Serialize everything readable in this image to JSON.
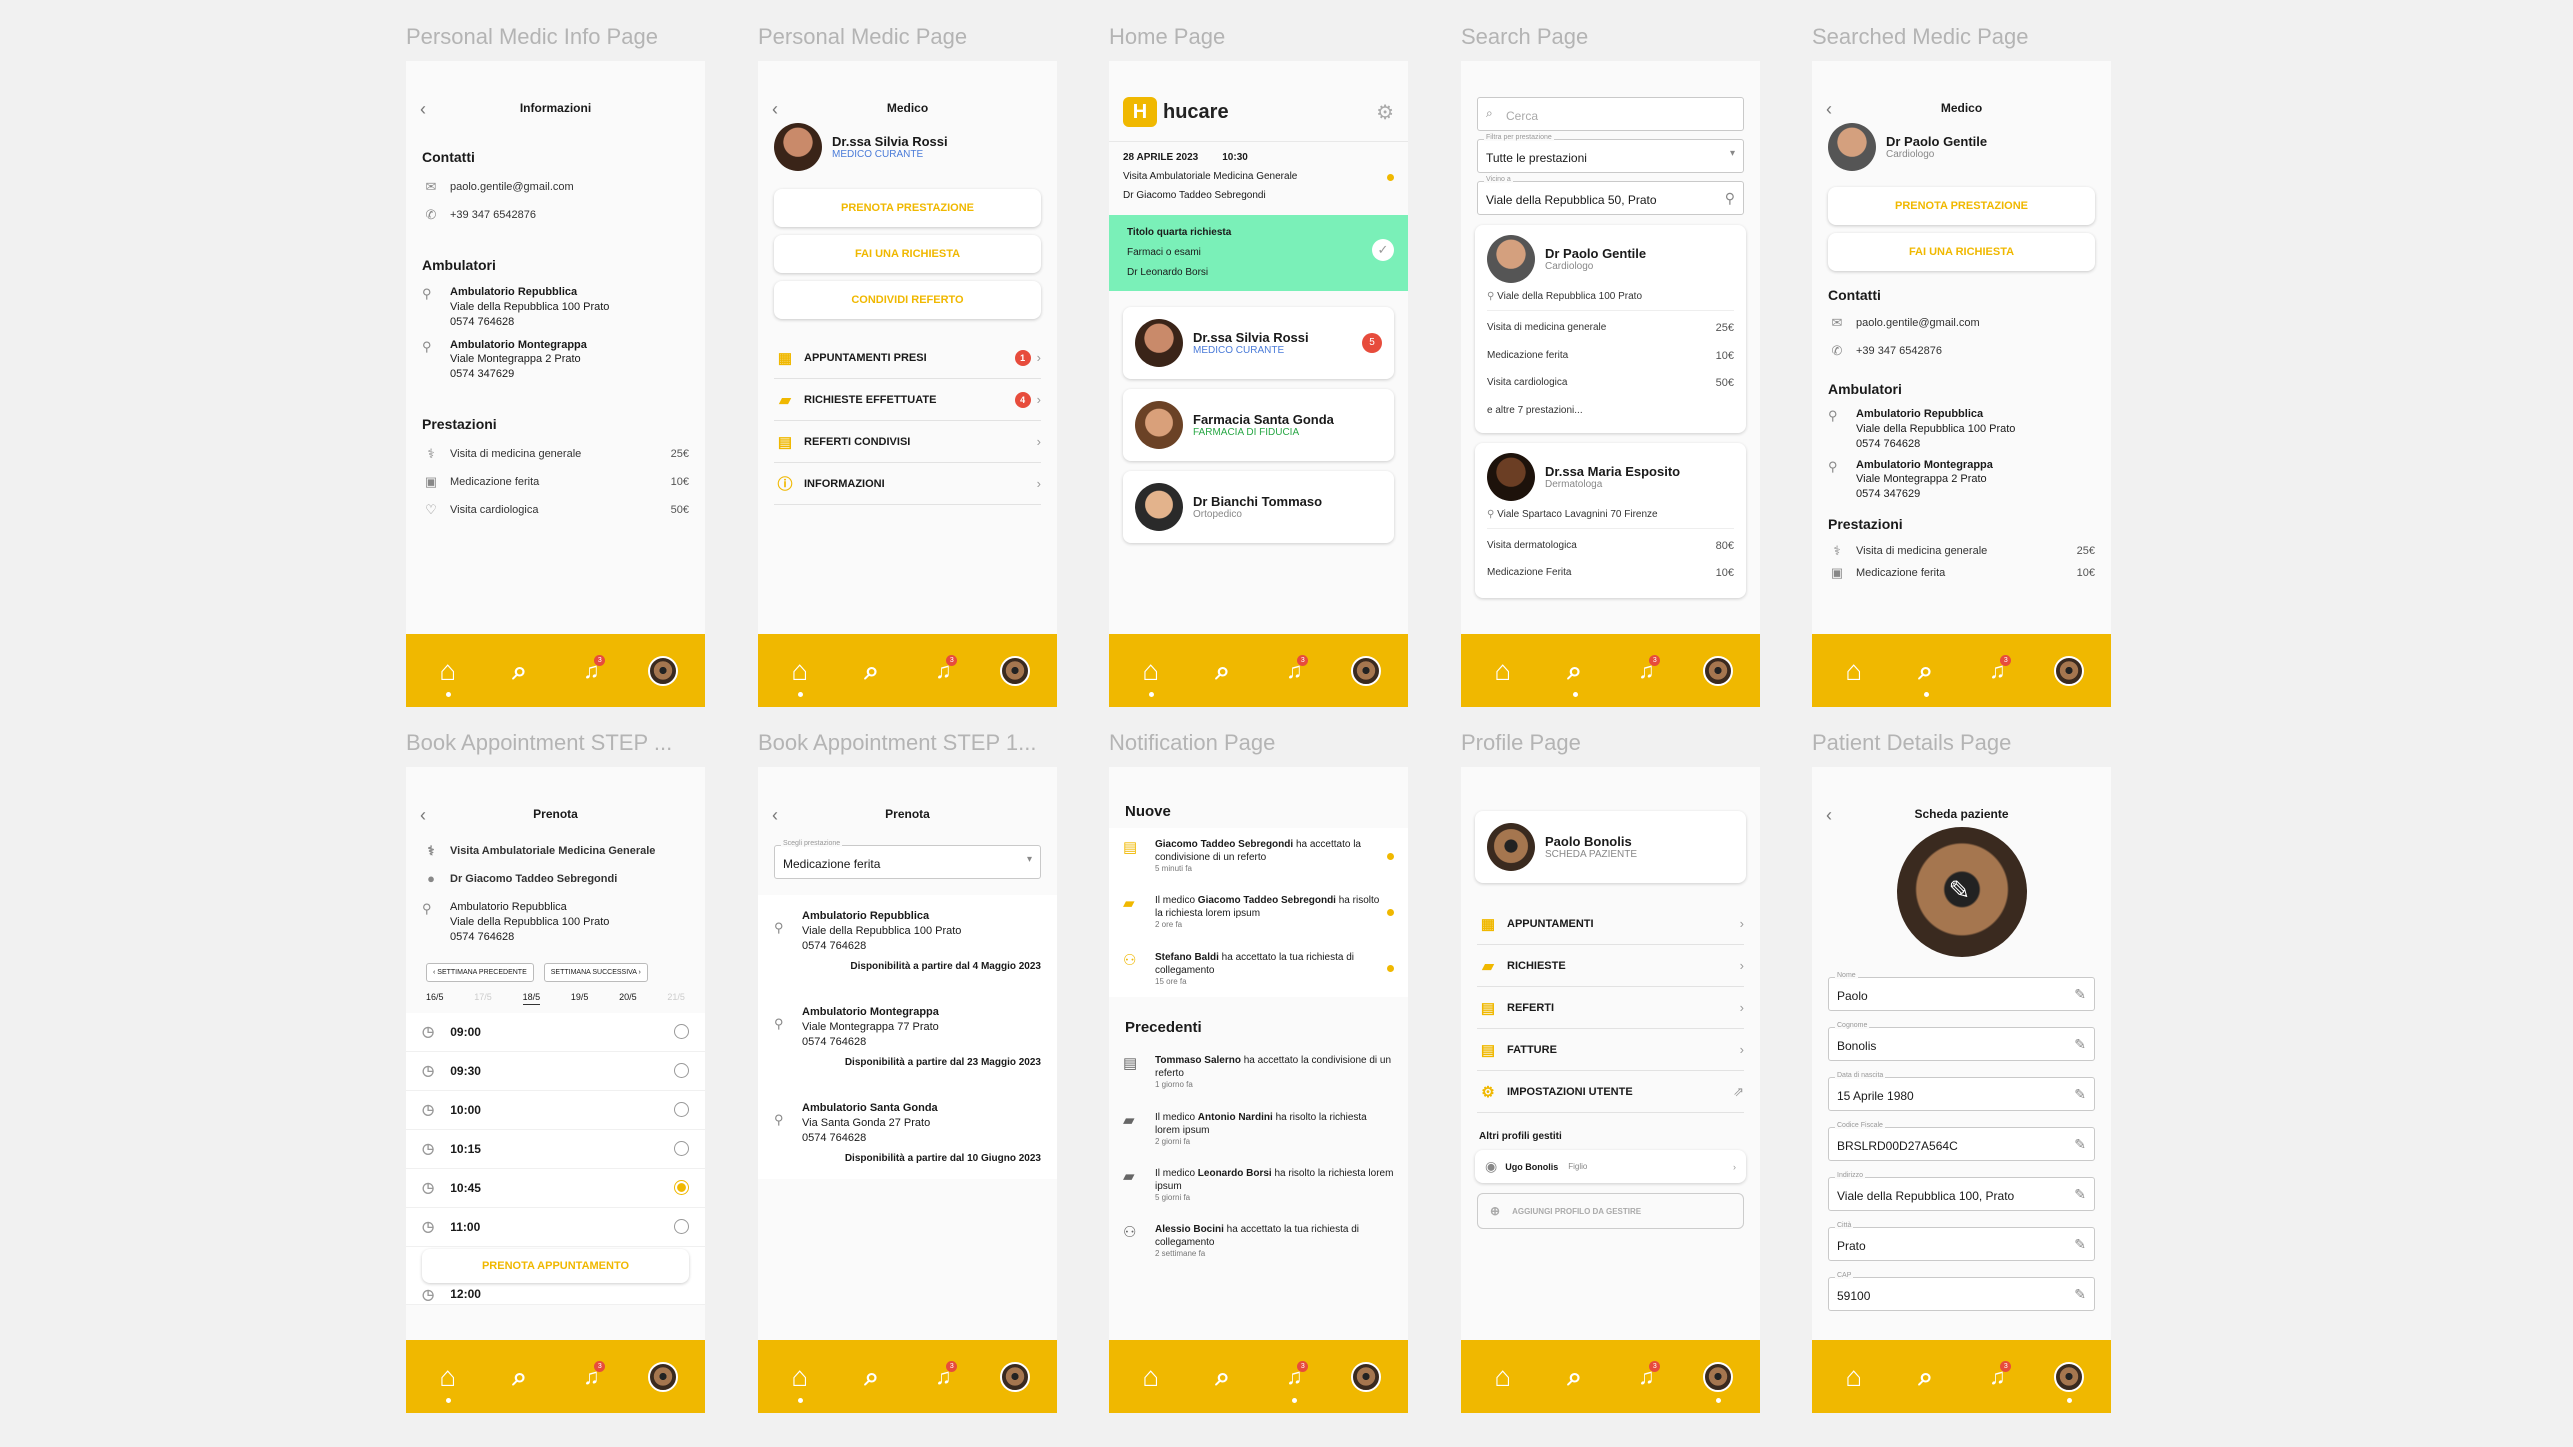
{
  "titles": [
    "Personal Medic Info Page",
    "Personal Medic Page",
    "Home Page",
    "Search Page",
    "Searched Medic Page",
    "Book Appointment STEP ...",
    "Book Appointment STEP 1...",
    "Notification Page",
    "Profile Page",
    "Patient Details Page"
  ],
  "nav": {
    "badge": "3"
  },
  "info": {
    "header": "Informazioni",
    "contacts_title": "Contatti",
    "email": "paolo.gentile@gmail.com",
    "phone": "+39 347 6542876",
    "ambulatori_title": "Ambulatori",
    "ambulatori": [
      {
        "name": "Ambulatorio Repubblica",
        "addr": "Viale della Repubblica 100 Prato",
        "tel": "0574 764628"
      },
      {
        "name": "Ambulatorio Montegrappa",
        "addr": "Viale Montegrappa 2 Prato",
        "tel": "0574 347629"
      }
    ],
    "prestazioni_title": "Prestazioni",
    "prestazioni": [
      {
        "name": "Visita di medicina generale",
        "price": "25€"
      },
      {
        "name": "Medicazione ferita",
        "price": "10€"
      },
      {
        "name": "Visita cardiologica",
        "price": "50€"
      }
    ]
  },
  "medic": {
    "header": "Medico",
    "name": "Dr.ssa Silvia Rossi",
    "role": "MEDICO CURANTE",
    "btn1": "PRENOTA PRESTAZIONE",
    "btn2": "FAI UNA RICHIESTA",
    "btn3": "CONDIVIDI REFERTO",
    "menu": [
      {
        "label": "APPUNTAMENTI PRESI",
        "badge": "1"
      },
      {
        "label": "RICHIESTE EFFETTUATE",
        "badge": "4"
      },
      {
        "label": "REFERTI CONDIVISI",
        "badge": ""
      },
      {
        "label": "INFORMAZIONI",
        "badge": ""
      }
    ]
  },
  "home": {
    "logo": "hucare",
    "appt": {
      "date": "28 APRILE 2023",
      "time": "10:30",
      "title": "Visita Ambulatoriale Medicina Generale",
      "doctor": "Dr Giacomo Taddeo Sebregondi"
    },
    "request": {
      "title": "Titolo quarta richiesta",
      "sub": "Farmaci o esami",
      "doctor": "Dr Leonardo Borsi"
    },
    "cards": [
      {
        "name": "Dr.ssa Silvia Rossi",
        "role": "MEDICO CURANTE",
        "badge": "5"
      },
      {
        "name": "Farmacia Santa Gonda",
        "role": "FARMACIA DI FIDUCIA",
        "badge": ""
      },
      {
        "name": "Dr Bianchi Tommaso",
        "role": "Ortopedico",
        "badge": ""
      }
    ]
  },
  "search": {
    "placeholder": "Cerca",
    "filter_label": "Filtra per prestazione",
    "filter_value": "Tutte le prestazioni",
    "near_label": "Vicino a",
    "near_value": "Viale della Repubblica 50, Prato",
    "r1": {
      "name": "Dr  Paolo Gentile",
      "role": "Cardiologo",
      "addr": "Viale della Repubblica 100 Prato",
      "services": [
        {
          "name": "Visita di medicina generale",
          "price": "25€"
        },
        {
          "name": "Medicazione ferita",
          "price": "10€"
        },
        {
          "name": "Visita cardiologica",
          "price": "50€"
        }
      ],
      "more": "e altre 7 prestazioni..."
    },
    "r2": {
      "name": "Dr.ssa  Maria Esposito",
      "role": "Dermatologa",
      "addr": "Viale Spartaco Lavagnini 70 Firenze",
      "services": [
        {
          "name": "Visita dermatologica",
          "price": "80€"
        },
        {
          "name": "Medicazione Ferita",
          "price": "10€"
        }
      ]
    }
  },
  "searched": {
    "header": "Medico",
    "name": "Dr  Paolo Gentile",
    "role": "Cardiologo",
    "btn1": "PRENOTA PRESTAZIONE",
    "btn2": "FAI UNA RICHIESTA",
    "contacts_title": "Contatti",
    "email": "paolo.gentile@gmail.com",
    "phone": "+39 347 6542876",
    "ambulatori_title": "Ambulatori",
    "ambulatori": [
      {
        "name": "Ambulatorio Repubblica",
        "addr": "Viale della Repubblica 100 Prato",
        "tel": "0574 764628"
      },
      {
        "name": "Ambulatorio Montegrappa",
        "addr": "Viale Montegrappa 2 Prato",
        "tel": "0574 347629"
      }
    ],
    "prestazioni_title": "Prestazioni",
    "prestazioni": [
      {
        "name": "Visita di medicina generale",
        "price": "25€"
      },
      {
        "name": "Medicazione ferita",
        "price": "10€"
      }
    ]
  },
  "book2": {
    "header": "Prenota",
    "service": "Visita Ambulatoriale Medicina Generale",
    "doctor": "Dr Giacomo Taddeo Sebregondi",
    "amb_name": "Ambulatorio Repubblica",
    "amb_addr": "Viale della Repubblica 100 Prato",
    "amb_tel": "0574 764628",
    "prev": "SETTIMANA PRECEDENTE",
    "next": "SETTIMANA SUCCESSIVA",
    "days": [
      "16/5",
      "17/5",
      "18/5",
      "19/5",
      "20/5",
      "21/5"
    ],
    "times": [
      "09:00",
      "09:30",
      "10:00",
      "10:15",
      "10:45",
      "11:00",
      "12:00"
    ],
    "selected_time": "10:45",
    "cta": "PRENOTA APPUNTAMENTO"
  },
  "book1": {
    "header": "Prenota",
    "select_label": "Scegli prestazione",
    "select_value": "Medicazione ferita",
    "ambulatori": [
      {
        "name": "Ambulatorio Repubblica",
        "addr": "Viale della Repubblica 100 Prato",
        "tel": "0574 764628",
        "avail": "Disponibilità a partire dal 4 Maggio 2023"
      },
      {
        "name": "Ambulatorio Montegrappa",
        "addr": "Viale Montegrappa 77 Prato",
        "tel": "0574 764628",
        "avail": "Disponibilità a partire dal 23 Maggio 2023"
      },
      {
        "name": "Ambulatorio Santa Gonda",
        "addr": "Via Santa Gonda 27 Prato",
        "tel": "0574 764628",
        "avail": "Disponibilità a partire dal 10 Giugno 2023"
      }
    ]
  },
  "notif": {
    "new_title": "Nuove",
    "prev_title": "Precedenti",
    "new": [
      {
        "who": "Giacomo Taddeo Sebregondi",
        "pre": "",
        "post": " ha accettato la condivisione di un referto",
        "time": "5 minuti fa"
      },
      {
        "who": "Giacomo Taddeo Sebregondi",
        "pre": "Il medico ",
        "post": " ha risolto la richiesta lorem ipsum",
        "time": "2 ore fa"
      },
      {
        "who": "Stefano Baldi",
        "pre": "",
        "post": " ha accettato la tua richiesta di collegamento",
        "time": "15 ore fa"
      }
    ],
    "prev": [
      {
        "who": "Tommaso Salerno",
        "pre": "",
        "post": " ha accettato la condivisione di un referto",
        "time": "1 giorno fa"
      },
      {
        "who": "Antonio Nardini",
        "pre": "Il medico ",
        "post": " ha risolto la richiesta lorem ipsum",
        "time": "2 giorni fa"
      },
      {
        "who": "Leonardo Borsi",
        "pre": "Il medico ",
        "post": " ha risolto la richiesta lorem ipsum",
        "time": "5 giorni fa"
      },
      {
        "who": "Alessio Bocini",
        "pre": "",
        "post": " ha accettato la tua richiesta di collegamento",
        "time": "2 settimane fa"
      }
    ]
  },
  "profile": {
    "name": "Paolo Bonolis",
    "sub": "SCHEDA PAZIENTE",
    "menu": [
      "APPUNTAMENTI",
      "RICHIESTE",
      "REFERTI",
      "FATTURE",
      "IMPOSTAZIONI UTENTE"
    ],
    "others_title": "Altri profili gestiti",
    "other_name": "Ugo Bonolis",
    "other_rel": "Figlio",
    "add": "AGGIUNGI PROFILO DA GESTIRE"
  },
  "patient": {
    "header": "Scheda paziente",
    "fields": [
      {
        "label": "Nome",
        "value": "Paolo"
      },
      {
        "label": "Cognome",
        "value": "Bonolis"
      },
      {
        "label": "Data di nascita",
        "value": "15 Aprile 1980"
      },
      {
        "label": "Codice Fiscale",
        "value": "BRSLRD00D27A564C"
      },
      {
        "label": "Indirizzo",
        "value": "Viale della Repubblica 100, Prato"
      },
      {
        "label": "Città",
        "value": "Prato"
      },
      {
        "label": "CAP",
        "value": "59100"
      }
    ]
  }
}
